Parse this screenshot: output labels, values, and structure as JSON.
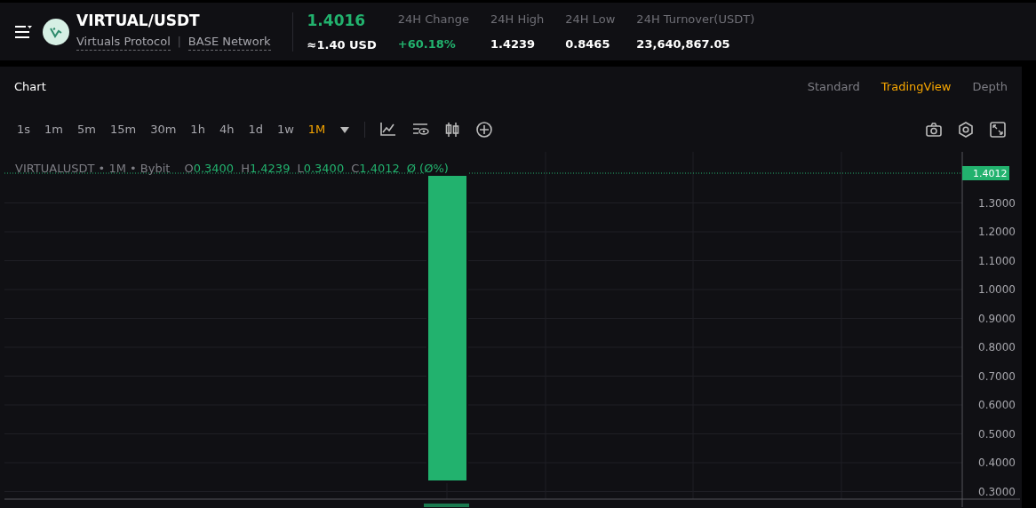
{
  "header": {
    "pair": "VIRTUAL/USDT",
    "links": [
      "Virtuals Protocol",
      "BASE Network"
    ],
    "link_separator": "|",
    "price": "1.4016",
    "price_usd": "≈1.40 USD",
    "stats": [
      {
        "label": "24H Change",
        "value": "+60.18%",
        "kind": "up"
      },
      {
        "label": "24H High",
        "value": "1.4239",
        "kind": "plain"
      },
      {
        "label": "24H Low",
        "value": "0.8465",
        "kind": "plain"
      },
      {
        "label": "24H Turnover(USDT)",
        "value": "23,640,867.05",
        "kind": "plain"
      }
    ]
  },
  "panel": {
    "title": "Chart",
    "views": [
      {
        "label": "Standard",
        "selected": false
      },
      {
        "label": "TradingView",
        "selected": true
      },
      {
        "label": "Depth",
        "selected": false
      }
    ]
  },
  "intervals": [
    {
      "label": "1s",
      "selected": false
    },
    {
      "label": "1m",
      "selected": false
    },
    {
      "label": "5m",
      "selected": false
    },
    {
      "label": "15m",
      "selected": false
    },
    {
      "label": "30m",
      "selected": false
    },
    {
      "label": "1h",
      "selected": false
    },
    {
      "label": "4h",
      "selected": false
    },
    {
      "label": "1d",
      "selected": false
    },
    {
      "label": "1w",
      "selected": false
    },
    {
      "label": "1M",
      "selected": true
    }
  ],
  "legend": {
    "symbol": "VIRTUALUSDT • 1M • Bybit",
    "ohlc": [
      {
        "label": "O",
        "value": "0.3400"
      },
      {
        "label": "H",
        "value": "1.4239"
      },
      {
        "label": "L",
        "value": "0.3400"
      },
      {
        "label": "C",
        "value": "1.4012"
      }
    ],
    "change": "Ø (Ø%)"
  },
  "price_tag": "1.4012",
  "price_axis": [
    "1.3000",
    "1.2000",
    "1.1000",
    "1.0000",
    "0.9000",
    "0.8000",
    "0.7000",
    "0.6000",
    "0.5000",
    "0.4000",
    "0.3000"
  ]
}
